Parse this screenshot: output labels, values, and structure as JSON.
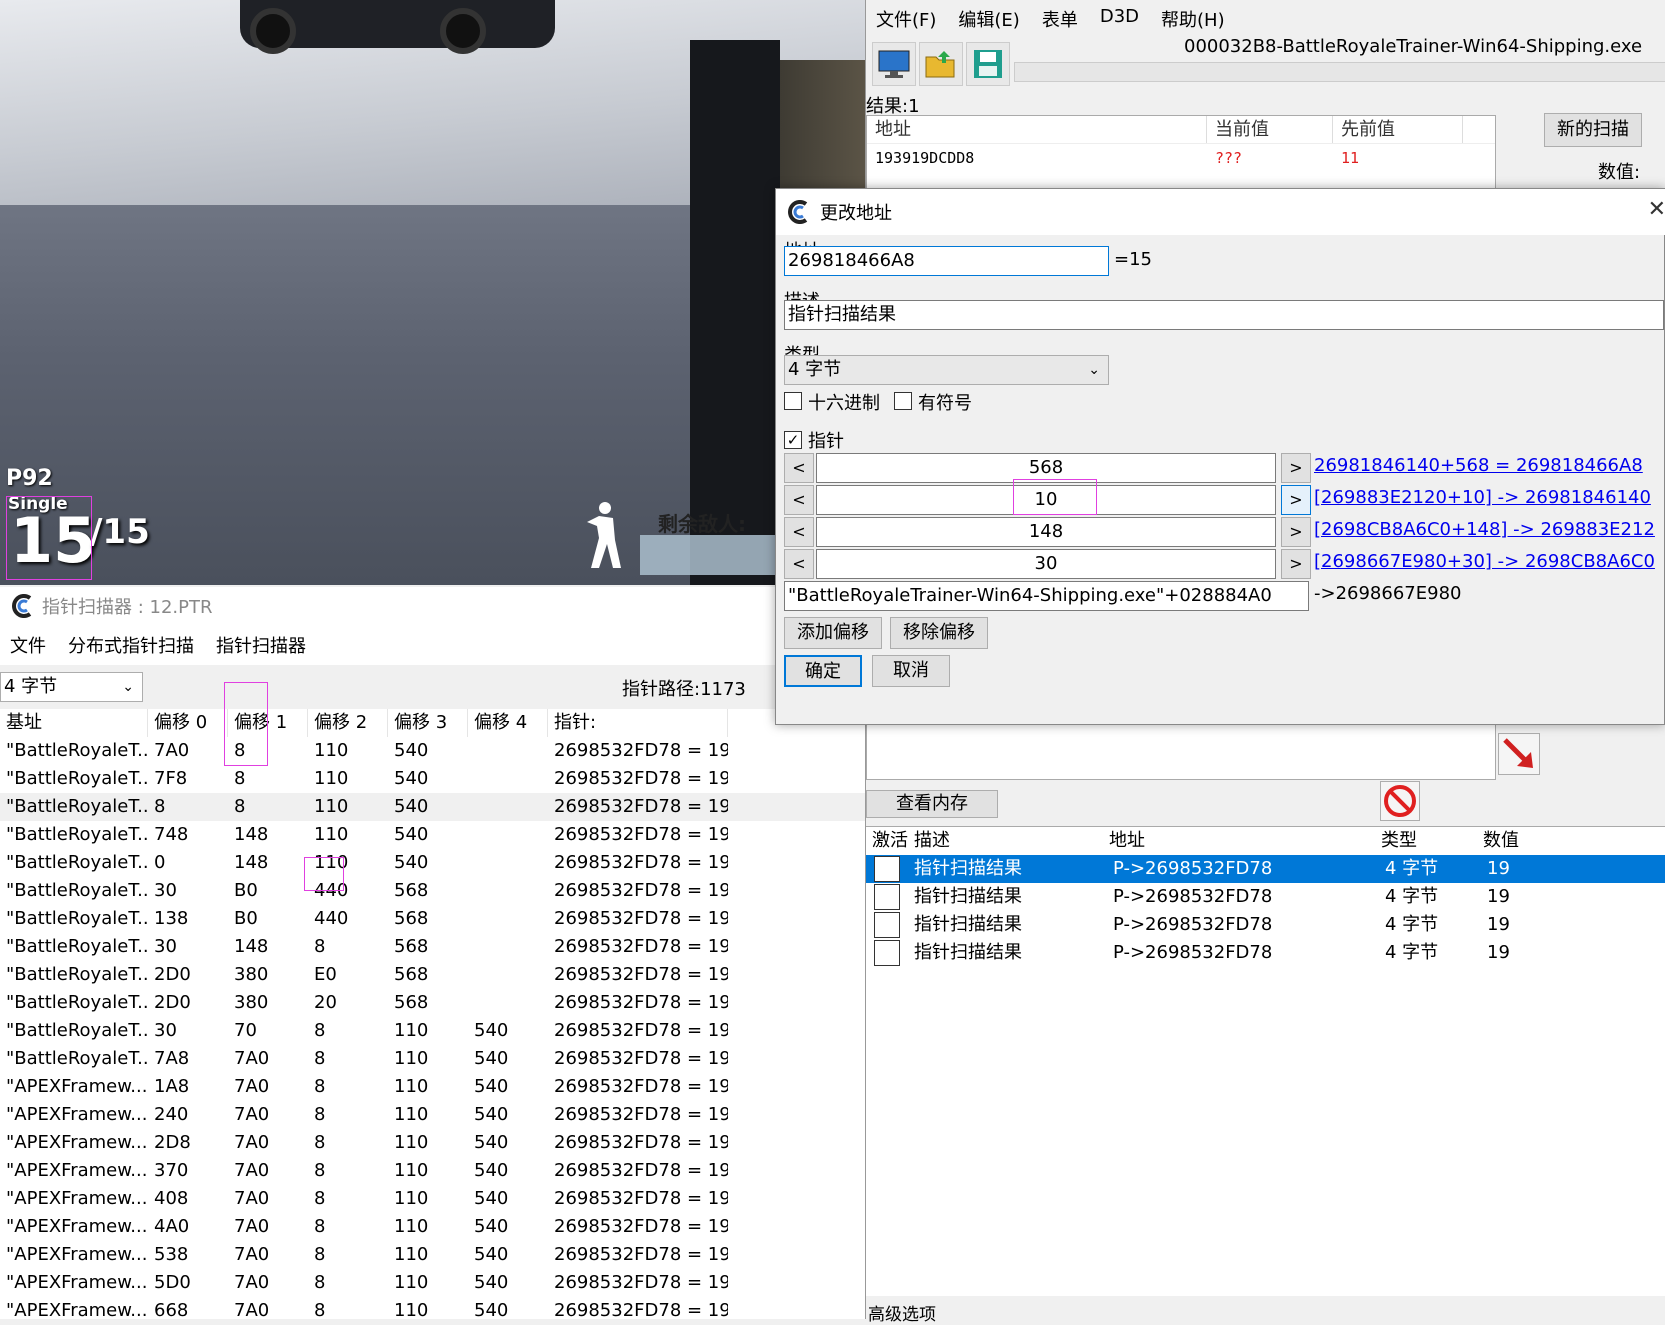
{
  "game": {
    "weapon": "P92",
    "fire_mode": "Single",
    "ammo": "15",
    "ammo_max": "/15",
    "enemies_label": "剩余敌人:"
  },
  "pointer_scanner": {
    "title": "指针扫描器 : 12.PTR",
    "menu": [
      "文件",
      "分布式指针扫描",
      "指针扫描器"
    ],
    "type_value": "4 字节",
    "path_count": "指针路径:1173",
    "columns": [
      "基址",
      "偏移 0",
      "偏移 1",
      "偏移 2",
      "偏移 3",
      "偏移 4",
      "指针:"
    ],
    "rows": [
      [
        "\"BattleRoyaleT...",
        "7A0",
        "8",
        "110",
        "540",
        "",
        "2698532FD78 = 19"
      ],
      [
        "\"BattleRoyaleT...",
        "7F8",
        "8",
        "110",
        "540",
        "",
        "2698532FD78 = 19"
      ],
      [
        "\"BattleRoyaleT...",
        "8",
        "8",
        "110",
        "540",
        "",
        "2698532FD78 = 19"
      ],
      [
        "\"BattleRoyaleT...",
        "748",
        "148",
        "110",
        "540",
        "",
        "2698532FD78 = 19"
      ],
      [
        "\"BattleRoyaleT...",
        "0",
        "148",
        "110",
        "540",
        "",
        "2698532FD78 = 19"
      ],
      [
        "\"BattleRoyaleT...",
        "30",
        "B0",
        "440",
        "568",
        "",
        "2698532FD78 = 19"
      ],
      [
        "\"BattleRoyaleT...",
        "138",
        "B0",
        "440",
        "568",
        "",
        "2698532FD78 = 19"
      ],
      [
        "\"BattleRoyaleT...",
        "30",
        "148",
        "8",
        "568",
        "",
        "2698532FD78 = 19"
      ],
      [
        "\"BattleRoyaleT...",
        "2D0",
        "380",
        "E0",
        "568",
        "",
        "2698532FD78 = 19"
      ],
      [
        "\"BattleRoyaleT...",
        "2D0",
        "380",
        "20",
        "568",
        "",
        "2698532FD78 = 19"
      ],
      [
        "\"BattleRoyaleT...",
        "30",
        "70",
        "8",
        "110",
        "540",
        "2698532FD78 = 19"
      ],
      [
        "\"BattleRoyaleT...",
        "7A8",
        "7A0",
        "8",
        "110",
        "540",
        "2698532FD78 = 19"
      ],
      [
        "\"APEXFramew...",
        "1A8",
        "7A0",
        "8",
        "110",
        "540",
        "2698532FD78 = 19"
      ],
      [
        "\"APEXFramew...",
        "240",
        "7A0",
        "8",
        "110",
        "540",
        "2698532FD78 = 19"
      ],
      [
        "\"APEXFramew...",
        "2D8",
        "7A0",
        "8",
        "110",
        "540",
        "2698532FD78 = 19"
      ],
      [
        "\"APEXFramew...",
        "370",
        "7A0",
        "8",
        "110",
        "540",
        "2698532FD78 = 19"
      ],
      [
        "\"APEXFramew...",
        "408",
        "7A0",
        "8",
        "110",
        "540",
        "2698532FD78 = 19"
      ],
      [
        "\"APEXFramew...",
        "4A0",
        "7A0",
        "8",
        "110",
        "540",
        "2698532FD78 = 19"
      ],
      [
        "\"APEXFramew...",
        "538",
        "7A0",
        "8",
        "110",
        "540",
        "2698532FD78 = 19"
      ],
      [
        "\"APEXFramew...",
        "5D0",
        "7A0",
        "8",
        "110",
        "540",
        "2698532FD78 = 19"
      ],
      [
        "\"APEXFramew...",
        "668",
        "7A0",
        "8",
        "110",
        "540",
        "2698532FD78 = 19"
      ]
    ]
  },
  "main": {
    "menu": [
      "文件(F)",
      "编辑(E)",
      "表单",
      "D3D",
      "帮助(H)"
    ],
    "process": "000032B8-BattleRoyaleTrainer-Win64-Shipping.exe",
    "results_label": "结果:1",
    "results_columns": [
      "地址",
      "当前值",
      "先前值"
    ],
    "results_row": [
      "193919DCDD8",
      "???",
      "11"
    ],
    "new_scan": "新的扫描",
    "value_label": "数值:",
    "view_memory": "查看内存",
    "table_columns": [
      "激活",
      "描述",
      "地址",
      "类型",
      "数值"
    ],
    "table_rows": [
      {
        "desc": "指针扫描结果",
        "addr": "P->2698532FD78",
        "type": "4 字节",
        "value": "19"
      },
      {
        "desc": "指针扫描结果",
        "addr": "P->2698532FD78",
        "type": "4 字节",
        "value": "19"
      },
      {
        "desc": "指针扫描结果",
        "addr": "P->2698532FD78",
        "type": "4 字节",
        "value": "19"
      },
      {
        "desc": "指针扫描结果",
        "addr": "P->2698532FD78",
        "type": "4 字节",
        "value": "19"
      }
    ],
    "advanced": "高级选项",
    "colors": {
      "selection": "#0078d7",
      "red_value": "#e02020",
      "link": "#0000ee",
      "highlight_box": "#e040e0"
    }
  },
  "dialog": {
    "title": "更改地址",
    "address_label": "地址:",
    "address_value": "269818466A8",
    "address_result": "=15",
    "desc_label": "描述",
    "desc_value": "指针扫描结果",
    "type_label": "类型",
    "type_value": "4 字节",
    "hex_label": "十六进制",
    "signed_label": "有符号",
    "pointer_label": "指针",
    "offsets": [
      {
        "value": "568",
        "link": "26981846140+568 = 269818466A8"
      },
      {
        "value": "10",
        "link": "[269883E2120+10] -> 26981846140"
      },
      {
        "value": "148",
        "link": "[2698CB8A6C0+148] -> 269883E212"
      },
      {
        "value": "30",
        "link": "[2698667E980+30] -> 2698CB8A6C0"
      }
    ],
    "base_value": "\"BattleRoyaleTrainer-Win64-Shipping.exe\"+028884A0",
    "base_result": "->2698667E980",
    "add_offset": "添加偏移",
    "remove_offset": "移除偏移",
    "ok": "确定",
    "cancel": "取消"
  }
}
